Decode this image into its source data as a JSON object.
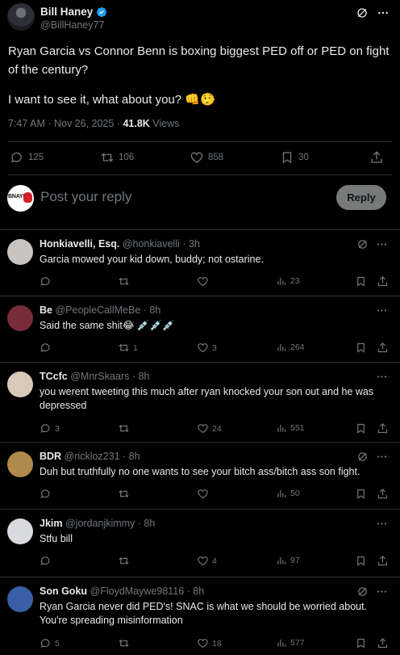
{
  "main_tweet": {
    "author_name": "Bill Haney",
    "author_handle": "@BillHaney77",
    "text_line1": "Ryan Garcia vs Connor Benn is boxing biggest PED off or PED on fight of the century?",
    "text_line2": "I want to see it, what about you? 👊🤥",
    "time": "7:47 AM · Nov 26, 2025 · ",
    "views_count": "41.8K",
    "views_label": " Views",
    "stats": {
      "replies": "125",
      "reposts": "106",
      "likes": "858",
      "bookmarks": "30"
    }
  },
  "composer": {
    "placeholder": "Post your reply",
    "reply_button": "Reply",
    "avatar_text": "BNAYL"
  },
  "replies": [
    {
      "name": "Honkiavelli, Esq.",
      "handle": "@honkiavelli",
      "time": " · 3h",
      "text": "Garcia mowed your kid down, buddy; not ostarine.",
      "replies": "",
      "reposts": "",
      "likes": "",
      "views": "23",
      "avatar_color": "#c9c3bf",
      "has_grok": true
    },
    {
      "name": "Be",
      "handle": "@PeopleCallMeBe",
      "time": " · 8h",
      "text": "Said the same shit😂 💉💉💉",
      "replies": "",
      "reposts": "1",
      "likes": "3",
      "views": "264",
      "avatar_color": "#7a2b3a",
      "has_grok": false
    },
    {
      "name": "TCcfc",
      "handle": "@MnrSkaars",
      "time": " · 8h",
      "text": "you werent tweeting this much after ryan knocked your son out and he was depressed",
      "replies": "3",
      "reposts": "",
      "likes": "24",
      "views": "551",
      "avatar_color": "#d8c9b8",
      "has_grok": false
    },
    {
      "name": "BDR",
      "handle": "@rickloz231",
      "time": " · 8h",
      "text": "Duh but truthfully no one wants to see your bitch ass/bitch ass son fight.",
      "replies": "",
      "reposts": "",
      "likes": "",
      "views": "50",
      "avatar_color": "#b08a4a",
      "has_grok": true
    },
    {
      "name": "Jkim",
      "handle": "@jordanjkimmy",
      "time": " · 8h",
      "text": "Stfu bill",
      "replies": "",
      "reposts": "",
      "likes": "4",
      "views": "97",
      "avatar_color": "#d9d9e0",
      "has_grok": false
    },
    {
      "name": "Son Goku",
      "handle": "@FloydMaywe98116",
      "time": " · 8h",
      "text": "Ryan Garcia never did PED's! SNAC is what we should be worried about. You're spreading misinformation",
      "replies": "5",
      "reposts": "",
      "likes": "18",
      "views": "577",
      "avatar_color": "#3a5fa8",
      "has_grok": true
    }
  ]
}
